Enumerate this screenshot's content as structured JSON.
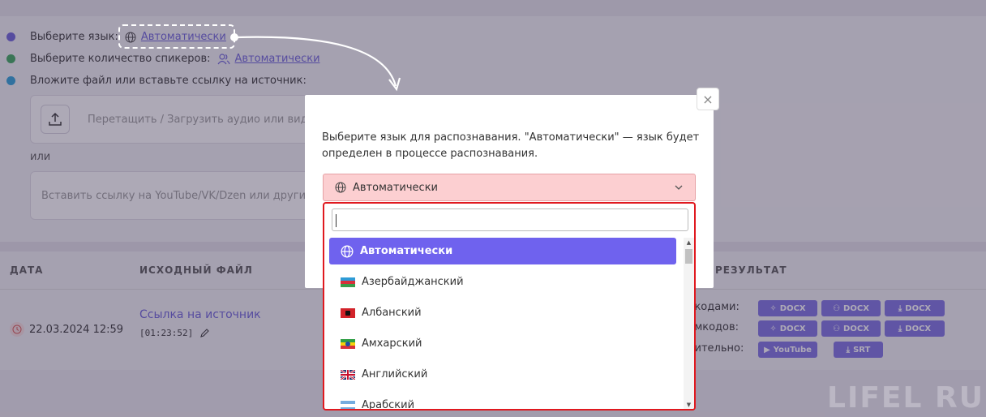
{
  "steps": {
    "language_label": "Выберите язык:",
    "language_value": "Автоматически",
    "speakers_label": "Выберите количество спикеров:",
    "speakers_value": "Автоматически",
    "file_label": "Вложите файл или вставьте ссылку на источник:"
  },
  "upload": {
    "placeholder": "Перетащить / Загрузить аудио или виде"
  },
  "or_text": "или",
  "link_input": {
    "placeholder": "Вставить ссылку на YouTube/VK/Dzen или другие"
  },
  "table": {
    "headers": {
      "date": "ДАТА",
      "source": "ИСХОДНЫЙ ФАЙЛ",
      "result": "РЕЗУЛЬТАТ"
    },
    "row": {
      "date": "22.03.2024 12:59",
      "source_link": "Ссылка на источник",
      "duration": "[01:23:52]",
      "result_labels": [
        "икодами:",
        "ймкодов:",
        "нительно:"
      ],
      "chips": {
        "docx": "DOCX",
        "youtube": "YouTube",
        "srt": "SRT"
      }
    }
  },
  "watermark": "LIFEL RU",
  "modal": {
    "description": "Выберите язык для распознавания. \"Автоматически\" — язык будет определен в процессе распознавания.",
    "selected": "Автоматически",
    "close": "×"
  },
  "dropdown": {
    "search_value": "",
    "options": [
      {
        "label": "Автоматически",
        "icon": "globe-icon",
        "selected": true
      },
      {
        "label": "Азербайджанский",
        "icon": "flag-az-icon",
        "selected": false
      },
      {
        "label": "Албанский",
        "icon": "flag-al-icon",
        "selected": false
      },
      {
        "label": "Амхарский",
        "icon": "flag-et-icon",
        "selected": false
      },
      {
        "label": "Английский",
        "icon": "flag-gb-icon",
        "selected": false
      },
      {
        "label": "Арабский",
        "icon": "flag-ar-icon",
        "selected": false
      }
    ]
  },
  "colors": {
    "accent": "#6f62ee",
    "select_error_bg": "#fccfd1",
    "dropdown_border": "#e0191f"
  }
}
